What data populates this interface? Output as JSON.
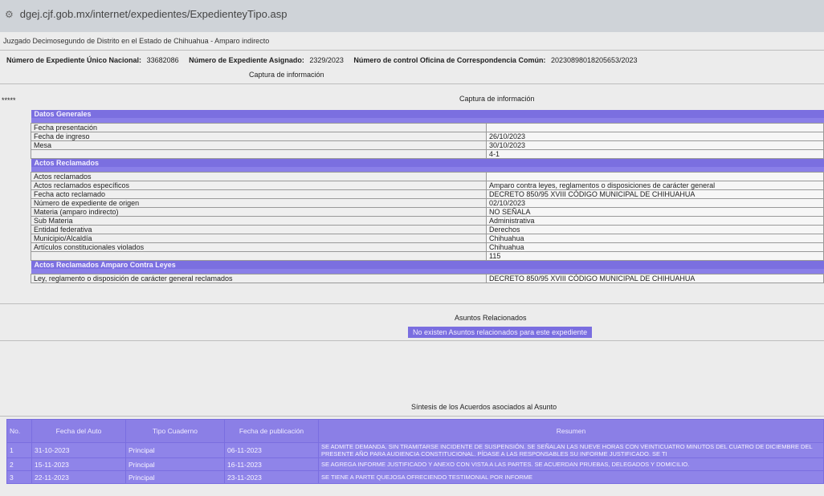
{
  "browser": {
    "url": "dgej.cjf.gob.mx/internet/expedientes/ExpedienteyTipo.asp"
  },
  "header": {
    "court": "Juzgado Decimosegundo de Distrito en el Estado de Chihuahua - Amparo indirecto",
    "numero_unico_label": "Número de Expediente Único Nacional:",
    "numero_unico_value": "33682086",
    "numero_asignado_label": "Número de Expediente Asignado:",
    "numero_asignado_value": "2329/2023",
    "control_label": "Número de control Oficina de Correspondencia Común:",
    "control_value": "20230898018205653/2023",
    "captura_1": "Captura de información",
    "stars": "*****",
    "captura_2": "Captura de información"
  },
  "datos_generales": {
    "title": "Datos Generales",
    "rows": [
      {
        "label": "Fecha presentación",
        "value": ""
      },
      {
        "label": "Fecha de ingreso",
        "value": "26/10/2023"
      },
      {
        "label": "Mesa",
        "value": "30/10/2023"
      },
      {
        "label": "",
        "value": "4-1"
      }
    ]
  },
  "actos": {
    "title": "Actos Reclamados",
    "rows": [
      {
        "label": "Actos reclamados",
        "value": ""
      },
      {
        "label": "Actos reclamados específicos",
        "value": "Amparo contra leyes, reglamentos o disposiciones de carácter general"
      },
      {
        "label": "Fecha acto reclamado",
        "value": "DECRETO 850/95 XVIII CÓDIGO MUNICIPAL DE CHIHUAHUA"
      },
      {
        "label": "Número de expediente de origen",
        "value": "02/10/2023"
      },
      {
        "label": "Materia (amparo indirecto)",
        "value": "NO SEÑALA"
      },
      {
        "label": "Sub Materia",
        "value": "Administrativa"
      },
      {
        "label": "Entidad federativa",
        "value": "Derechos"
      },
      {
        "label": "Municipio/Alcaldía",
        "value": "Chihuahua"
      },
      {
        "label": "Artículos constitucionales violados",
        "value": "Chihuahua"
      },
      {
        "label": "",
        "value": "115"
      }
    ]
  },
  "actos_leyes": {
    "title": "Actos Reclamados Amparo Contra Leyes",
    "rows": [
      {
        "label": "Ley, reglamento o disposición de carácter general reclamados",
        "value": "DECRETO 850/95 XVIII CÓDIGO MUNICIPAL DE CHIHUAHUA"
      }
    ]
  },
  "asuntos": {
    "title": "Asuntos Relacionados",
    "empty": "No existen Asuntos relacionados para este expediente"
  },
  "sintesis": {
    "title": "Síntesis de los Acuerdos asociados al Asunto",
    "columns": [
      "No.",
      "Fecha del Auto",
      "Tipo Cuaderno",
      "Fecha de publicación",
      "Resumen"
    ],
    "rows": [
      {
        "no": "1",
        "fecha_auto": "31-10-2023",
        "tipo": "Principal",
        "fecha_pub": "06-11-2023",
        "resumen": "SE ADMITE DEMANDA. SIN TRAMITARSE INCIDENTE DE SUSPENSIÓN. SE SEÑALAN LAS NUEVE HORAS CON VEINTICUATRO MINUTOS DEL CUATRO DE DICIEMBRE DEL PRESENTE AÑO PARA AUDIENCIA CONSTITUCIONAL. PÍDASE A LAS RESPONSABLES SU INFORME JUSTIFICADO. SE TI"
      },
      {
        "no": "2",
        "fecha_auto": "15-11-2023",
        "tipo": "Principal",
        "fecha_pub": "16-11-2023",
        "resumen": "SE AGREGA INFORME JUSTIFICADO Y ANEXO CON VISTA A LAS PARTES. SE ACUERDAN PRUEBAS, DELEGADOS Y DOMICILIO."
      },
      {
        "no": "3",
        "fecha_auto": "22-11-2023",
        "tipo": "Principal",
        "fecha_pub": "23-11-2023",
        "resumen": "SE TIENE A PARTE QUEJOSA OFRECIENDO TESTIMONIAL POR INFORME"
      }
    ]
  }
}
